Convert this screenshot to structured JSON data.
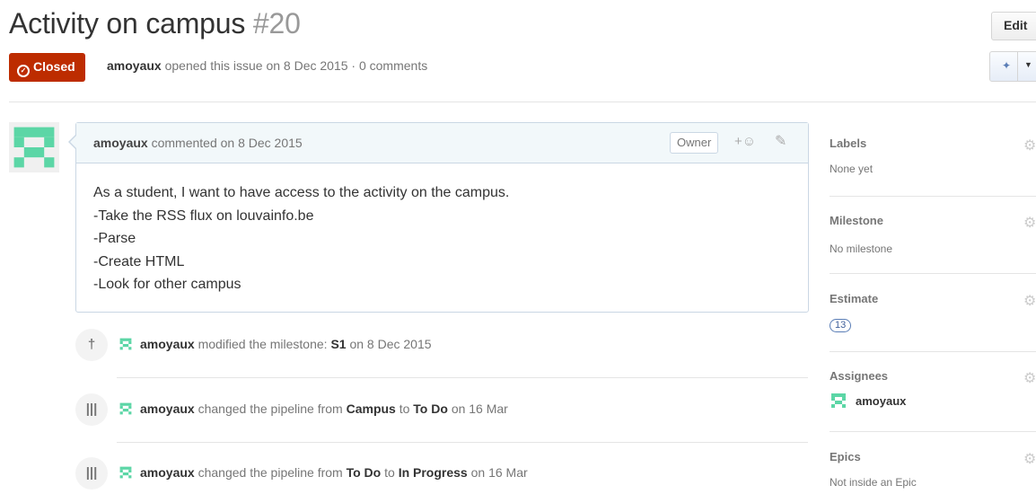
{
  "issue": {
    "title": "Activity on campus",
    "number": "#20",
    "state": "Closed",
    "author": "amoyaux",
    "meta_text": "opened this issue on 8 Dec 2015 · 0 comments"
  },
  "toolbar": {
    "edit_label": "Edit"
  },
  "comment": {
    "author": "amoyaux",
    "meta": "commented on 8 Dec 2015",
    "role_badge": "Owner",
    "lines": [
      "As a student, I want to have access to the activity on the campus.",
      "-Take the RSS flux on louvainfo.be",
      "-Parse",
      "-Create HTML",
      "-Look for other campus"
    ]
  },
  "events": [
    {
      "actor": "amoyaux",
      "a": "modified the milestone:",
      "b": "S1",
      "c": "on 8 Dec 2015",
      "d": "",
      "e": ""
    },
    {
      "actor": "amoyaux",
      "a": "changed the pipeline from",
      "b": "Campus",
      "c": "to",
      "d": "To Do",
      "e": "on 16 Mar"
    },
    {
      "actor": "amoyaux",
      "a": "changed the pipeline from",
      "b": "To Do",
      "c": "to",
      "d": "In Progress",
      "e": "on 16 Mar"
    }
  ],
  "sidebar": {
    "labels": {
      "heading": "Labels",
      "value": "None yet"
    },
    "milestone": {
      "heading": "Milestone",
      "value": "No milestone"
    },
    "estimate": {
      "heading": "Estimate",
      "value": "13"
    },
    "assignees": {
      "heading": "Assignees",
      "value": "amoyaux"
    },
    "epics": {
      "heading": "Epics",
      "value": "Not inside an Epic"
    }
  },
  "colors": {
    "closed": "#bd2c00",
    "avatar": "#5cd6a6",
    "comment_border": "#cad7e4",
    "comment_header": "#f2f8fa"
  }
}
